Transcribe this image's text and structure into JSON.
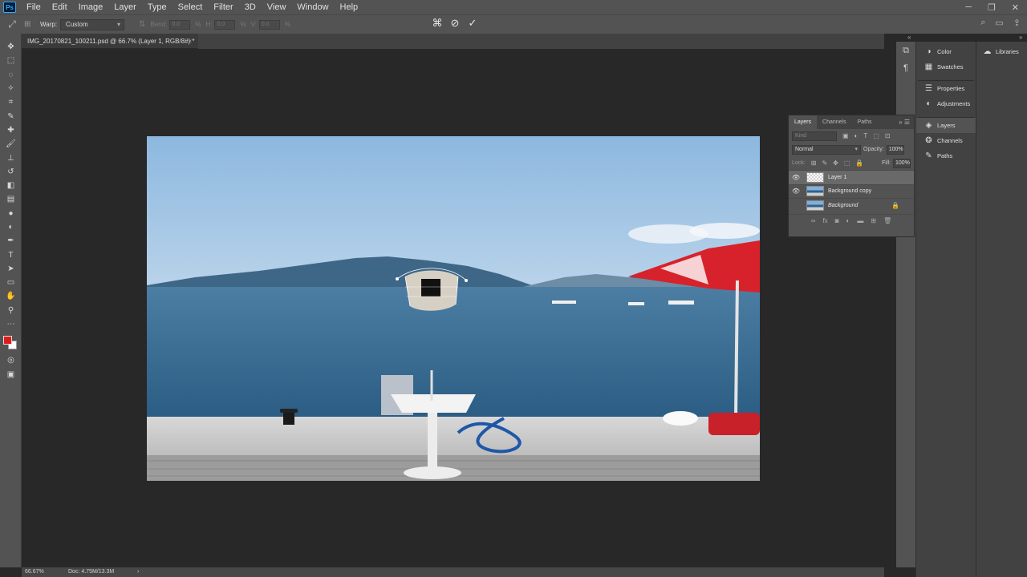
{
  "app": {
    "logo_text": "Ps"
  },
  "menu": [
    "File",
    "Edit",
    "Image",
    "Layer",
    "Type",
    "Select",
    "Filter",
    "3D",
    "View",
    "Window",
    "Help"
  ],
  "options": {
    "warp_label": "Warp:",
    "warp_value": "Custom",
    "bend_label": "Bend:",
    "bend_value": "0.0",
    "h_label": "H:",
    "h_value": "0.0",
    "v_label": "V:",
    "v_value": "0.0",
    "unit": "%"
  },
  "document": {
    "tab_title": "IMG_20170821_100211.psd @ 66.7% (Layer 1, RGB/8#) *",
    "close": "×"
  },
  "status": {
    "zoom": "66.67%",
    "doc": "Doc: 4.75M/13.3M",
    "arrow": "›"
  },
  "panel_column": {
    "items": [
      {
        "label": "Color",
        "icon": "color-wheel-icon"
      },
      {
        "label": "Swatches",
        "icon": "grid-icon"
      },
      {
        "label": "Properties",
        "icon": "properties-icon"
      },
      {
        "label": "Adjustments",
        "icon": "adjustments-icon"
      },
      {
        "label": "Layers",
        "icon": "layers-icon"
      },
      {
        "label": "Channels",
        "icon": "channels-icon"
      },
      {
        "label": "Paths",
        "icon": "paths-icon"
      }
    ]
  },
  "libraries": {
    "label": "Libraries",
    "icon": "cloud-icon"
  },
  "layers_panel": {
    "tabs": [
      "Layers",
      "Channels",
      "Paths"
    ],
    "kind_placeholder": "Kind",
    "blend_mode": "Normal",
    "opacity_label": "Opacity:",
    "opacity_value": "100%",
    "lock_label": "Lock:",
    "fill_label": "Fill:",
    "fill_value": "100%",
    "layers": [
      {
        "name": "Layer 1",
        "visible": true,
        "selected": true
      },
      {
        "name": "Background copy",
        "visible": true,
        "selected": false
      },
      {
        "name": "Background",
        "visible": false,
        "selected": false,
        "locked": true
      }
    ]
  },
  "colors": {
    "foreground": "#e01a1a",
    "background": "#ffffff",
    "ui_bg": "#535353",
    "canvas_bg": "#282828"
  }
}
